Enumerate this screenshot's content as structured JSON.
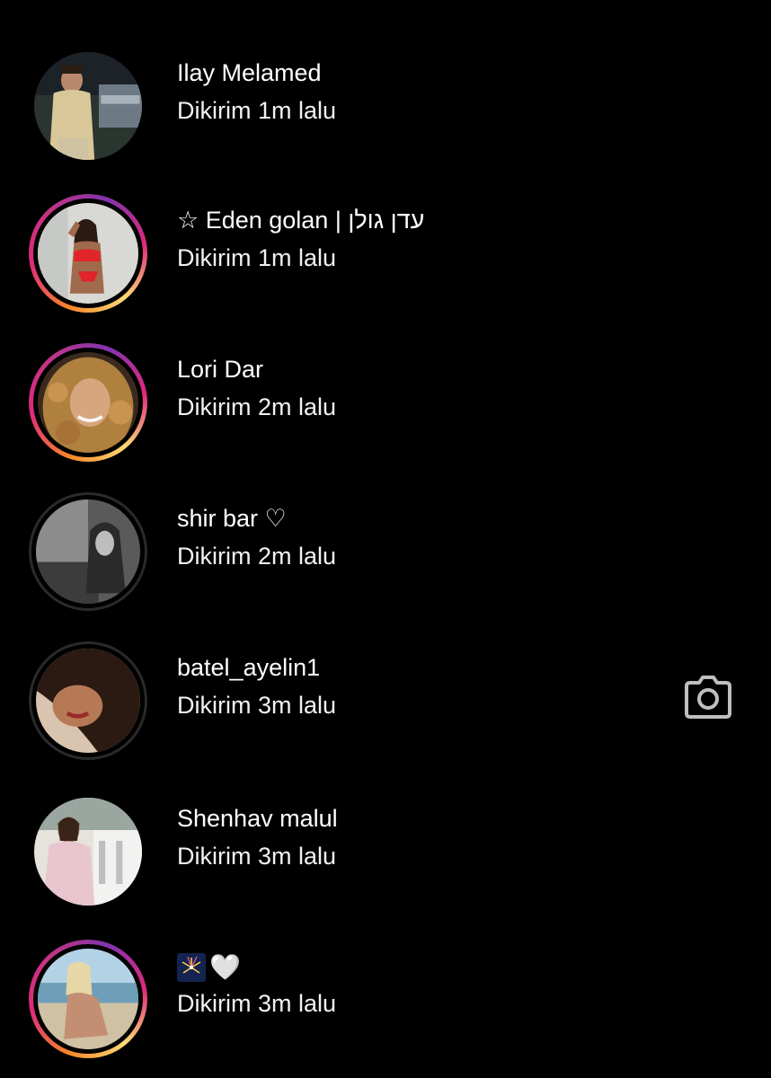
{
  "messages": [
    {
      "name": "Ilay Melamed",
      "status": "Dikirim 1m lalu",
      "ring": "none"
    },
    {
      "name": "☆ Eden golan | עדן גולן",
      "status": "Dikirim 1m lalu",
      "ring": "story"
    },
    {
      "name": "Lori Dar",
      "status": "Dikirim 2m lalu",
      "ring": "story"
    },
    {
      "name": "shir bar ♡",
      "status": "Dikirim 2m lalu",
      "ring": "seen"
    },
    {
      "name": "batel_ayelin1",
      "status": "Dikirim 3m lalu",
      "ring": "seen"
    },
    {
      "name": "Shenhav malul",
      "status": "Dikirim 3m lalu",
      "ring": "none"
    },
    {
      "name": "🤍",
      "status": "Dikirim 3m lalu",
      "ring": "story",
      "name_prefix_icon": "fireworks-emoji"
    }
  ],
  "camera": {
    "icon": "camera-icon"
  },
  "colors": {
    "background": "#000000",
    "text": "#ffffff",
    "ring_gradient_start": "#f58529",
    "ring_gradient_mid": "#dd2a7b",
    "ring_gradient_end": "#8134af",
    "camera_icon": "#bfbfbf"
  }
}
